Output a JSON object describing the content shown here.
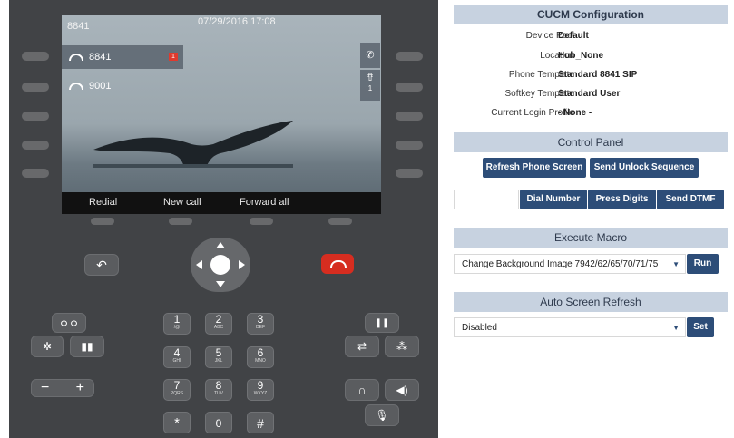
{
  "phone": {
    "screen": {
      "line_number": "8841",
      "datetime": "07/29/2016 17:08",
      "lines": [
        {
          "label": "8841",
          "badge": "1"
        },
        {
          "label": "9001"
        }
      ],
      "feature_icons": [
        "phone-icon",
        "call-forward-icon"
      ],
      "feature_badge": "1"
    },
    "softkeys": [
      "Redial",
      "New call",
      "Forward all"
    ],
    "dialpad": [
      {
        "digit": "1",
        "letters": "/@"
      },
      {
        "digit": "2",
        "letters": "ABC"
      },
      {
        "digit": "3",
        "letters": "DEF"
      },
      {
        "digit": "4",
        "letters": "GHI"
      },
      {
        "digit": "5",
        "letters": "JKL"
      },
      {
        "digit": "6",
        "letters": "MNO"
      },
      {
        "digit": "7",
        "letters": "PQRS"
      },
      {
        "digit": "8",
        "letters": "TUV"
      },
      {
        "digit": "9",
        "letters": "WXYZ"
      },
      {
        "digit": "*",
        "letters": ""
      },
      {
        "digit": "0",
        "letters": ""
      },
      {
        "digit": "#",
        "letters": ""
      }
    ],
    "volume": {
      "minus": "−",
      "plus": "+"
    }
  },
  "cucm": {
    "title": "CUCM Configuration",
    "rows": [
      {
        "label": "Device Pool",
        "value": "Default"
      },
      {
        "label": "Location",
        "value": "Hub_None"
      },
      {
        "label": "Phone Template",
        "value": "Standard 8841 SIP"
      },
      {
        "label": "Softkey Template",
        "value": "Standard User"
      },
      {
        "label": "Current Login Profile",
        "value": "- None -"
      }
    ]
  },
  "control_panel": {
    "title": "Control Panel",
    "refresh_button": "Refresh Phone Screen",
    "unlock_button": "Send Unlock Sequence",
    "dial_input_value": "",
    "dial_number_button": "Dial Number",
    "press_digits_button": "Press Digits",
    "send_dtmf_button": "Send DTMF"
  },
  "macro": {
    "title": "Execute Macro",
    "selected": "Change Background Image 7942/62/65/70/71/75",
    "run_button": "Run"
  },
  "auto_refresh": {
    "title": "Auto Screen Refresh",
    "selected": "Disabled",
    "set_button": "Set"
  },
  "colors": {
    "phone_body": "#414346",
    "header_bg": "#c7d2e0",
    "button_navy": "#2d4d78",
    "hangup_red": "#d62d20",
    "badge_red": "#e03a2e"
  }
}
